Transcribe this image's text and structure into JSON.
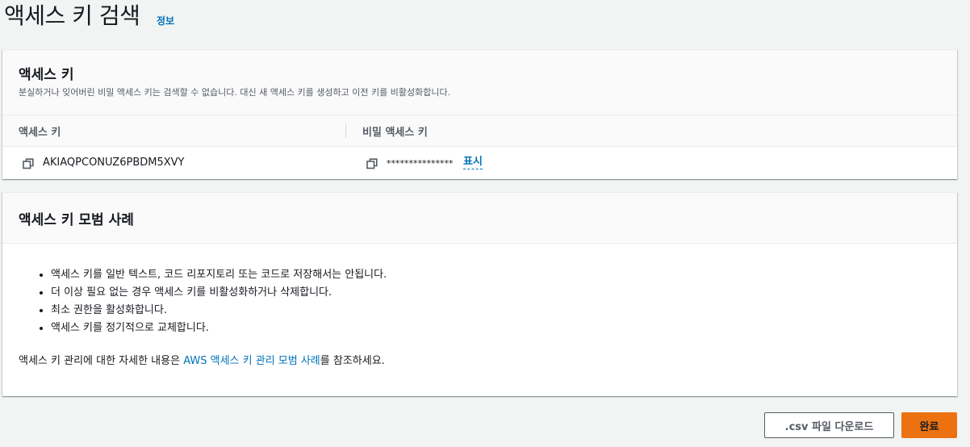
{
  "header": {
    "title": "액세스 키 검색",
    "info_link": "정보"
  },
  "access_key_panel": {
    "title": "액세스 키",
    "description": "분실하거나 잊어버린 비밀 액세스 키는 검색할 수 없습니다. 대신 새 액세스 키를 생성하고 이전 키를 비활성화합니다.",
    "columns": [
      "액세스 키",
      "비밀 액세스 키"
    ],
    "access_key_id": "AKIAQPCONUZ6PBDM5XVY",
    "secret_masked": "***************",
    "show_label": "표시",
    "copy_icon": "copy-icon"
  },
  "best_practices_panel": {
    "title": "액세스 키 모범 사례",
    "items": [
      "액세스 키를 일반 텍스트, 코드 리포지토리 또는 코드로 저장해서는 안됩니다.",
      "더 이상 필요 없는 경우 액세스 키를 비활성화하거나 삭제합니다.",
      "최소 권한을 활성화합니다.",
      "액세스 키를 정기적으로 교체합니다."
    ],
    "footer_prefix": "액세스 키 관리에 대한 자세한 내용은 ",
    "footer_link": "AWS 액세스 키 관리 모범 사례",
    "footer_suffix": "를 참조하세요."
  },
  "actions": {
    "download_csv": ".csv 파일 다운로드",
    "done": "완료"
  },
  "colors": {
    "link": "#0073bb",
    "primary_button": "#ec7211",
    "background": "#f2f3f3"
  }
}
